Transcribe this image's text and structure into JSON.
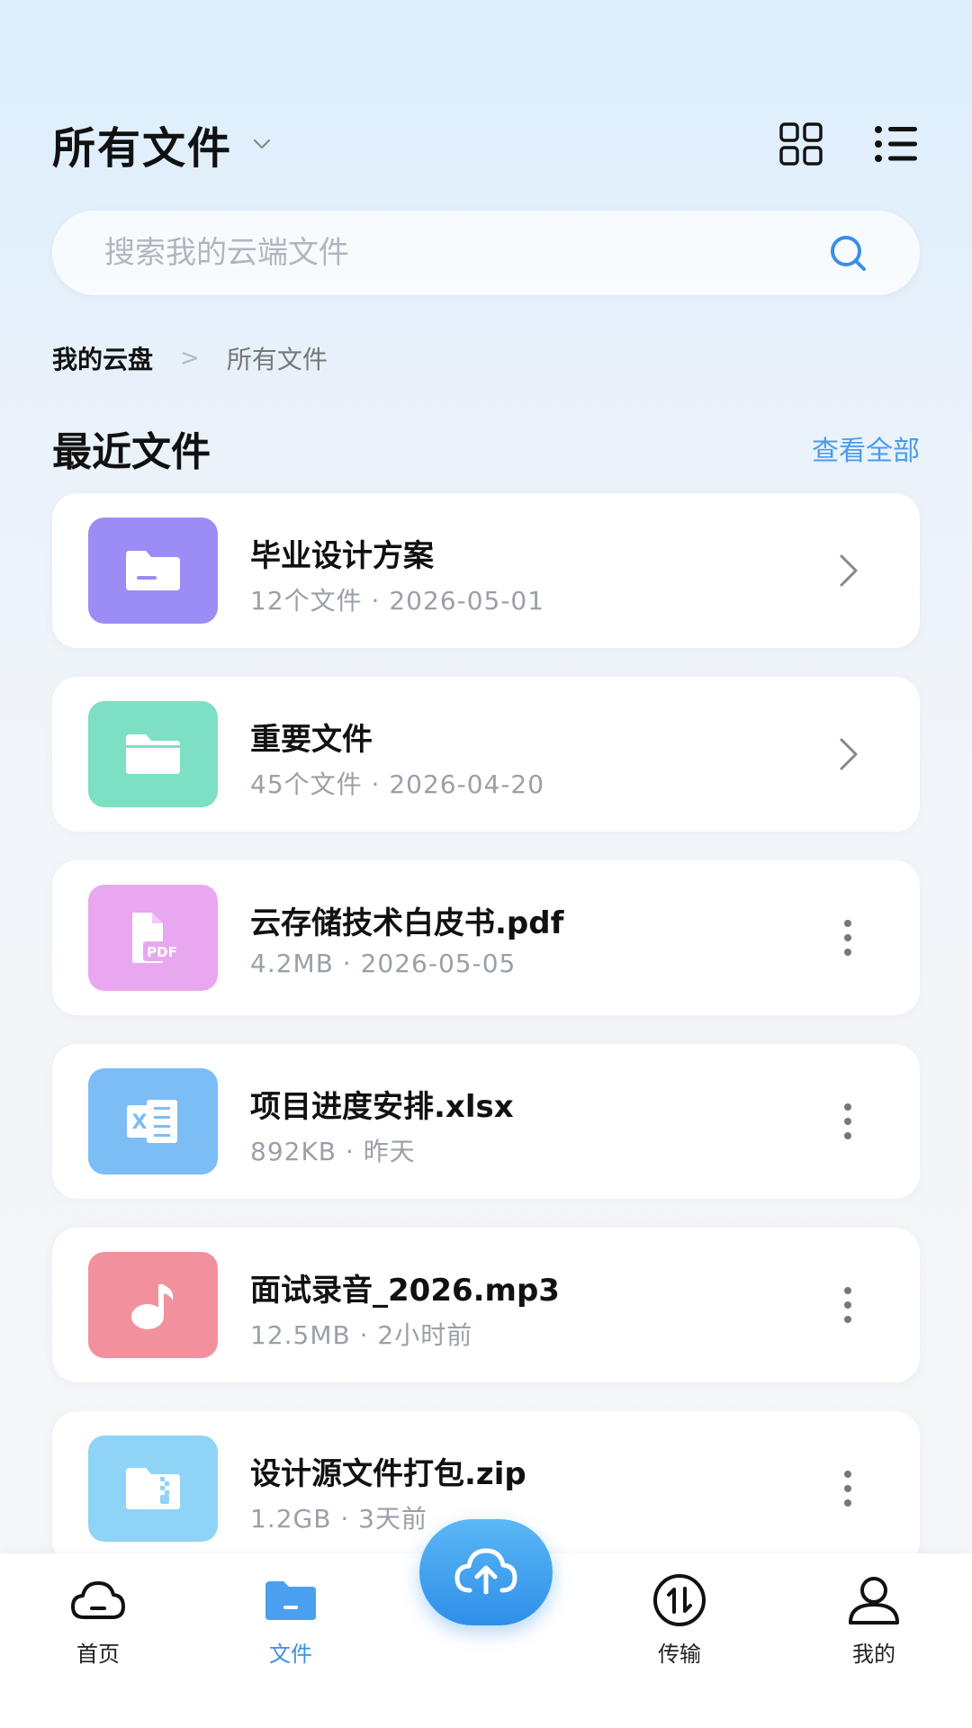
{
  "header": {
    "title": "所有文件"
  },
  "search": {
    "placeholder": "搜索我的云端文件"
  },
  "breadcrumb": {
    "root": "我的云盘",
    "separator": ">",
    "current": "所有文件"
  },
  "recent": {
    "title": "最近文件",
    "view_all": "查看全部"
  },
  "files": [
    {
      "name": "毕业设计方案",
      "meta": "12个文件 · 2026-05-01",
      "icon": "folder-icon",
      "color": "#9b8cf6",
      "action": "chevron-right"
    },
    {
      "name": "重要文件",
      "meta": "45个文件 · 2026-04-20",
      "icon": "folder-icon",
      "color": "#7ddfc4",
      "action": "chevron-right"
    },
    {
      "name": "云存储技术白皮书.pdf",
      "meta": "4.2MB · 2026-05-05",
      "icon": "pdf-icon",
      "color": "#e9a7f0",
      "action": "more"
    },
    {
      "name": "项目进度安排.xlsx",
      "meta": "892KB · 昨天",
      "icon": "excel-icon",
      "color": "#7dbdf5",
      "action": "more"
    },
    {
      "name": "面试录音_2026.mp3",
      "meta": "12.5MB · 2小时前",
      "icon": "music-icon",
      "color": "#f3909e",
      "action": "more"
    },
    {
      "name": "设计源文件打包.zip",
      "meta": "1.2GB · 3天前",
      "icon": "zip-icon",
      "color": "#8fd4f7",
      "action": "more"
    }
  ],
  "tabs": [
    {
      "label": "首页",
      "icon": "cloud-icon"
    },
    {
      "label": "文件",
      "icon": "folder-icon"
    },
    {
      "label": "传输",
      "icon": "transfer-icon"
    },
    {
      "label": "我的",
      "icon": "user-icon"
    }
  ],
  "colors": {
    "accent": "#3b8fe6",
    "link": "#4a9cec"
  }
}
